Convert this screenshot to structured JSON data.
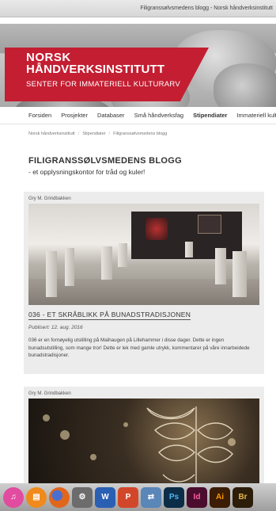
{
  "window": {
    "title": "Filigranssølvsmedens blogg - Norsk håndverksinstitutt"
  },
  "header": {
    "brand_line1": "NORSK",
    "brand_line2": "HÅNDVERKSINSTITUTT",
    "tagline": "SENTER FOR IMMATERIELL KULTURARV"
  },
  "nav": {
    "items": [
      "Forsiden",
      "Prosjekter",
      "Databaser",
      "Små håndverksfag",
      "Stipendiater",
      "Immateriell kult"
    ],
    "active": "Stipendiater"
  },
  "breadcrumb": [
    "Norsk håndverksinstitutt",
    "Stipendiater",
    "Filigranssølvsmedens blogg"
  ],
  "blog": {
    "title": "FILIGRANSSØLVSMEDENS BLOGG",
    "subtitle": "- et opplysningskontor for tråd og kuler!"
  },
  "posts": [
    {
      "author": "Gry M. Grindbakken",
      "title": "036 - ET SKRÅBLIKK PÅ BUNADSTRADISJONEN",
      "published": "Publisert: 12. aug. 2016",
      "excerpt": "036 er en fornøyelig utstilling på Maihaugen på Lillehammer i disse dager. Dette er ingen bunadsutstilling, som mange tror! Dette er lek med gamle utrykk, kommentarer på våre innarbeidede bunadstradisjoner."
    },
    {
      "author": "Gry M. Grindbakken"
    }
  ],
  "dock": {
    "icons": [
      {
        "name": "itunes-icon",
        "label": "♫",
        "color": "#e14ba0"
      },
      {
        "name": "ibooks-icon",
        "label": "📖",
        "color": "#f08a1c"
      },
      {
        "name": "firefox-icon",
        "label": "",
        "color": "#e0661b"
      },
      {
        "name": "system-preferences-icon",
        "label": "⚙",
        "color": "#6c6c6c"
      },
      {
        "name": "word-icon",
        "label": "W",
        "color": "#2b5fb4"
      },
      {
        "name": "powerpoint-icon",
        "label": "P",
        "color": "#d2472a"
      },
      {
        "name": "network-icon",
        "label": "⇄",
        "color": "#5a86b8"
      },
      {
        "name": "photoshop-icon",
        "label": "Ps",
        "color": "#0c2d47"
      },
      {
        "name": "indesign-icon",
        "label": "Id",
        "color": "#4a0d2e"
      },
      {
        "name": "illustrator-icon",
        "label": "Ai",
        "color": "#3b1c05"
      },
      {
        "name": "bridge-icon",
        "label": "Br",
        "color": "#2c1c0a"
      }
    ]
  }
}
